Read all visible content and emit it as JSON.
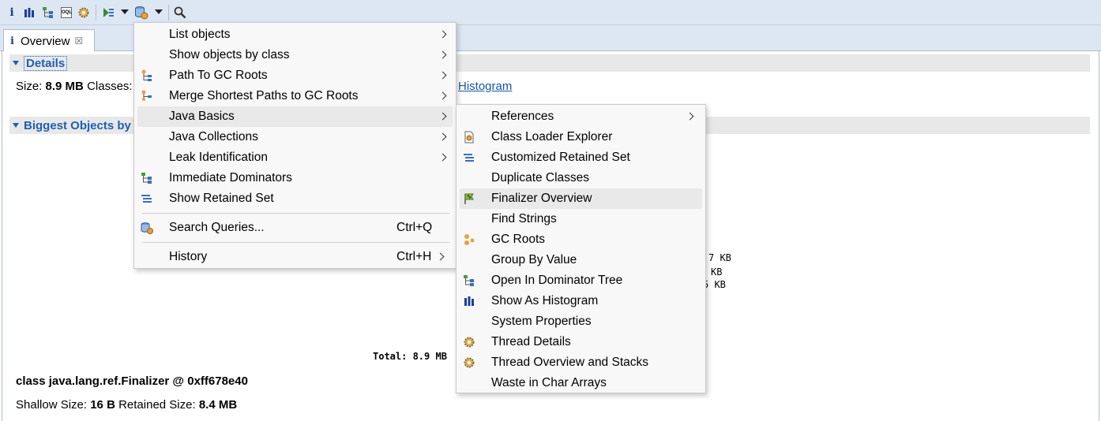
{
  "toolbar": {
    "icons": [
      "info-icon",
      "histogram-icon",
      "dominator-tree-icon",
      "oql-icon",
      "thread-gear-icon",
      "query-browser-icon",
      "run-report-icon",
      "search-icon"
    ],
    "oql_label": "OQL"
  },
  "tab": {
    "label": "Overview",
    "close": "☒"
  },
  "details": {
    "title": "Details",
    "size_label": "Size:",
    "size_value": "8.9 MB",
    "classes_label": "Classes:",
    "histogram_link": "Histogram"
  },
  "biggest": {
    "title": "Biggest Objects by"
  },
  "chart_fragments": {
    "kb1": "7 KB",
    "kb2": "KB",
    "kb3": "5 KB",
    "total": "Total: 8.9 MB"
  },
  "selected_object": {
    "title": "class java.lang.ref.Finalizer @ 0xff678e40",
    "shallow_label": "Shallow Size:",
    "shallow_value": "16 B",
    "retained_label": "Retained Size:",
    "retained_value": "8.4 MB"
  },
  "menu": {
    "items": [
      {
        "label": "List objects",
        "submenu": true
      },
      {
        "label": "Show objects by class",
        "submenu": true
      },
      {
        "label": "Path To GC Roots",
        "submenu": true,
        "icon": "path-to-gc-roots-icon"
      },
      {
        "label": "Merge Shortest Paths to GC Roots",
        "submenu": true,
        "icon": "merge-paths-icon"
      },
      {
        "label": "Java Basics",
        "submenu": true
      },
      {
        "label": "Java Collections",
        "submenu": true
      },
      {
        "label": "Leak Identification",
        "submenu": true
      },
      {
        "label": "Immediate Dominators",
        "icon": "immediate-dominators-icon"
      },
      {
        "label": "Show Retained Set",
        "icon": "retained-set-icon"
      },
      {
        "label": "Search Queries...",
        "shortcut": "Ctrl+Q",
        "icon": "search-queries-icon"
      },
      {
        "label": "History",
        "shortcut": "Ctrl+H",
        "submenu": true
      }
    ]
  },
  "submenu": {
    "items": [
      {
        "label": "References",
        "submenu": true
      },
      {
        "label": "Class Loader Explorer",
        "icon": "class-loader-icon"
      },
      {
        "label": "Customized Retained Set",
        "icon": "customized-retained-set-icon"
      },
      {
        "label": "Duplicate Classes"
      },
      {
        "label": "Finalizer Overview",
        "icon": "finalizer-icon"
      },
      {
        "label": "Find Strings"
      },
      {
        "label": "GC Roots",
        "icon": "gc-roots-icon"
      },
      {
        "label": "Group By Value"
      },
      {
        "label": "Open In Dominator Tree",
        "icon": "dominator-tree-icon"
      },
      {
        "label": "Show As Histogram",
        "icon": "histogram-icon"
      },
      {
        "label": "System Properties"
      },
      {
        "label": "Thread Details",
        "icon": "thread-gear-icon"
      },
      {
        "label": "Thread Overview and Stacks",
        "icon": "thread-gear-icon"
      },
      {
        "label": "Waste in Char Arrays"
      }
    ]
  }
}
